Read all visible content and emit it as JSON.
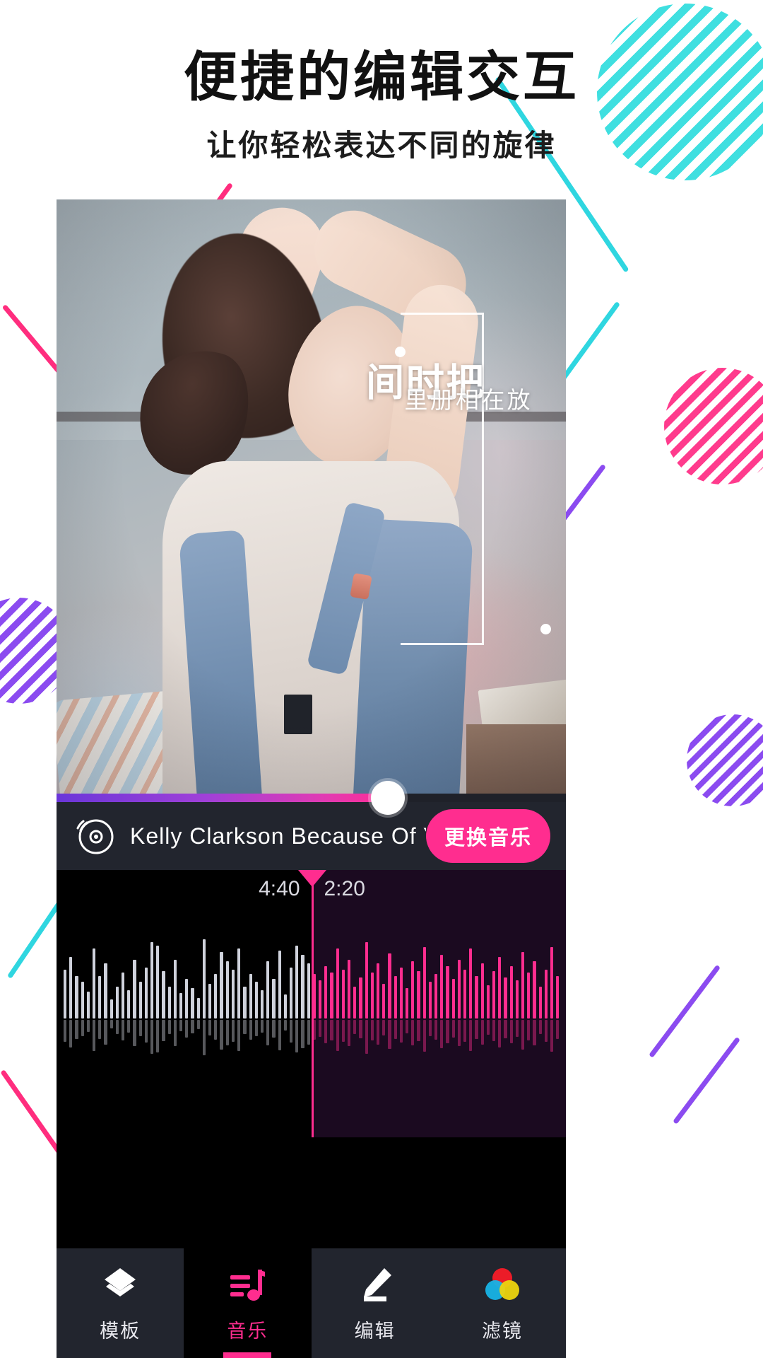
{
  "header": {
    "title": "便捷的编辑交互",
    "subtitle": "让你轻松表达不同的旋律"
  },
  "photo_overlay": {
    "main_text": "把时间",
    "sub_text": "放在相册里"
  },
  "player": {
    "disc_icon": "vinyl-record-icon",
    "track_name": "Kelly  Clarkson  Because Of You",
    "change_music_label": "更换音乐",
    "progress_percent": 65
  },
  "waveform": {
    "time_left": "4:40",
    "time_right": "2:20",
    "left_color": "#cfd2dc",
    "right_color": "#ff2d8f",
    "left_bg": "#000000",
    "right_bg": "#1b0a20",
    "playhead_color": "#ff2d8f",
    "bars": [
      62,
      78,
      54,
      46,
      34,
      88,
      54,
      70,
      24,
      40,
      58,
      36,
      74,
      46,
      64,
      96,
      92,
      60,
      40,
      74,
      32,
      50,
      38,
      26,
      100,
      44,
      56,
      84,
      72,
      62,
      88,
      40,
      56,
      46,
      36,
      72,
      50,
      86,
      30,
      64,
      92,
      80,
      70,
      56,
      48,
      66,
      58,
      88,
      62,
      74,
      40,
      52,
      96,
      58,
      70,
      44,
      82,
      54,
      64,
      38,
      72,
      60,
      90,
      46,
      56,
      80,
      66,
      50,
      74,
      62,
      88,
      54,
      70,
      42,
      60,
      78,
      52,
      66,
      48,
      84,
      58,
      72,
      40,
      62,
      90,
      54
    ]
  },
  "nav": {
    "items": [
      {
        "label": "模板",
        "icon": "layers-icon",
        "active": false
      },
      {
        "label": "音乐",
        "icon": "music-note-icon",
        "active": true
      },
      {
        "label": "编辑",
        "icon": "pencil-icon",
        "active": false
      },
      {
        "label": "滤镜",
        "icon": "color-circles-icon",
        "active": false
      }
    ]
  },
  "colors": {
    "accent_pink": "#ff2d8f",
    "accent_cyan": "#2fd6e0",
    "accent_purple": "#8b4bf0",
    "dark_bar": "#22252e"
  }
}
